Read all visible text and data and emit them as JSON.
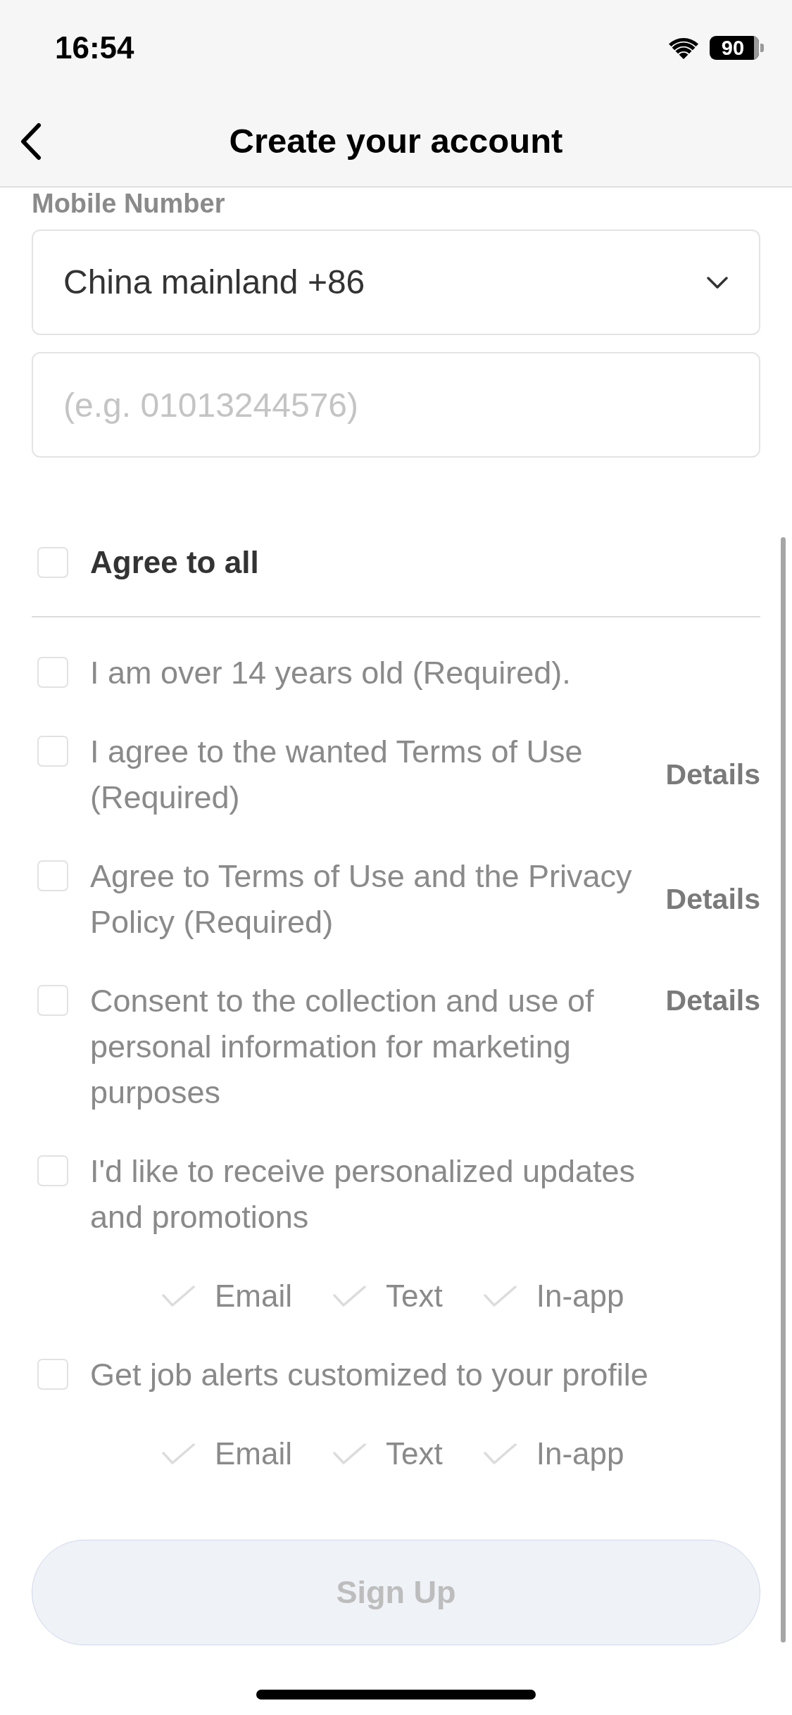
{
  "status_bar": {
    "time": "16:54",
    "battery": "90"
  },
  "header": {
    "title": "Create your account"
  },
  "mobile_number": {
    "label": "Mobile Number",
    "country_select": {
      "value": "China mainland +86"
    },
    "phone_input": {
      "placeholder": "(e.g. 01013244576)"
    }
  },
  "agree_all": {
    "label": "Agree to all",
    "checked": false
  },
  "agreements": [
    {
      "label": "I am over 14 years old (Required).",
      "checked": false
    },
    {
      "label": "I agree to the wanted Terms of Use (Required)",
      "checked": false,
      "details": "Details"
    },
    {
      "label": "Agree to Terms of Use and the Privacy Policy (Required)",
      "checked": false,
      "details": "Details"
    },
    {
      "label": "Consent to the collection and use of personal information for marketing purposes",
      "checked": false,
      "details": "Details"
    },
    {
      "label": "I'd like to receive personalized updates and promotions",
      "checked": false,
      "channels": [
        {
          "label": "Email",
          "selected": false
        },
        {
          "label": "Text",
          "selected": false
        },
        {
          "label": "In-app",
          "selected": false
        }
      ]
    },
    {
      "label": "Get job alerts customized to your profile",
      "checked": false,
      "channels": [
        {
          "label": "Email",
          "selected": false
        },
        {
          "label": "Text",
          "selected": false
        },
        {
          "label": "In-app",
          "selected": false
        }
      ]
    }
  ],
  "sign_up_button": {
    "label": "Sign Up",
    "disabled": true
  }
}
